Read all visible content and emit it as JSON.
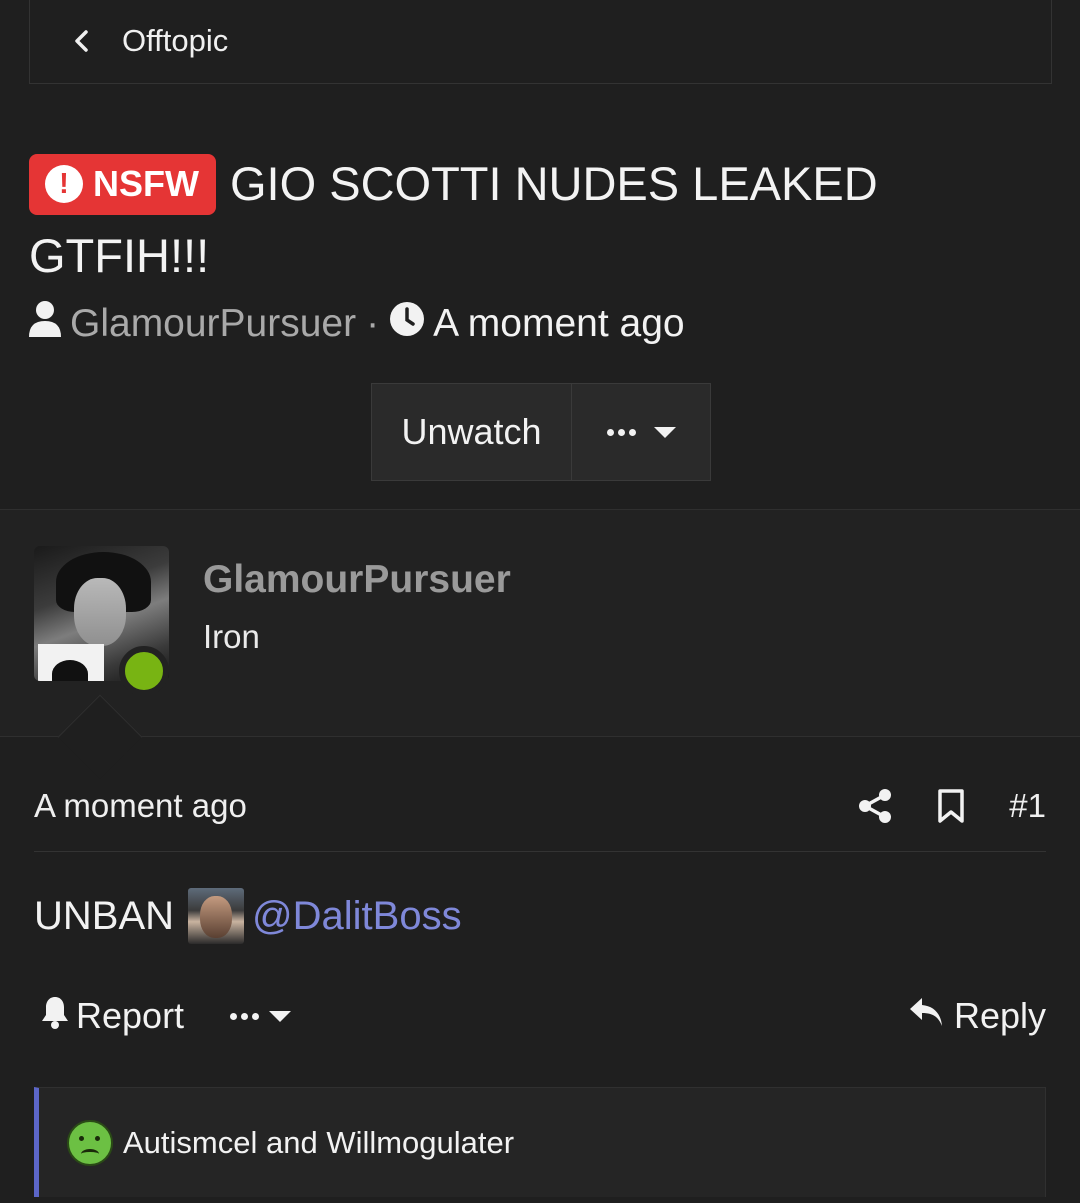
{
  "breadcrumb": {
    "label": "Offtopic"
  },
  "thread": {
    "badge": "NSFW",
    "title": "GIO SCOTTI NUDES LEAKED GTFIH!!!",
    "author": "GlamourPursuer",
    "time": "A moment ago",
    "separator": "·"
  },
  "watch": {
    "unwatch_label": "Unwatch"
  },
  "user": {
    "name": "GlamourPursuer",
    "rank": "Iron",
    "status": "online"
  },
  "post": {
    "time": "A moment ago",
    "number": "#1",
    "text": "UNBAN",
    "mention": "@DalitBoss"
  },
  "actions": {
    "report_label": "Report",
    "reply_label": "Reply"
  },
  "reactions": {
    "text": "Autismcel and Willmogulater"
  },
  "colors": {
    "accent": "#5c66c8",
    "nsfw": "#e53535",
    "online": "#78b413",
    "mention": "#7f88d9"
  }
}
